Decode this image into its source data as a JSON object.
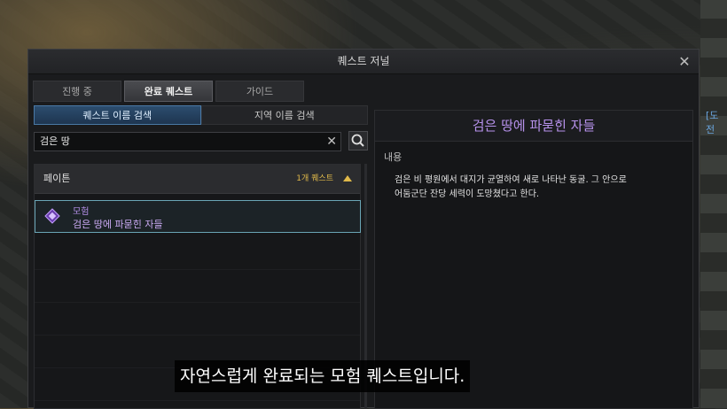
{
  "window": {
    "title": "퀘스트 저널"
  },
  "tabs": [
    {
      "label": "진행 중"
    },
    {
      "label": "완료 퀘스트"
    },
    {
      "label": "가이드"
    }
  ],
  "subtabs": [
    {
      "label": "퀘스트 이름 검색"
    },
    {
      "label": "지역 이름 검색"
    }
  ],
  "search": {
    "value": "검은 땅"
  },
  "group": {
    "name": "페이튼",
    "count": "1개 퀘스트"
  },
  "quest": {
    "type": "모험",
    "name": "검은 땅에 파묻힌 자들"
  },
  "detail": {
    "title": "검은 땅에 파묻힌 자들",
    "section_label": "내용",
    "description_line1": "검은 비 평원에서 대지가 균열하여 새로 나타난 동굴. 그 안으로",
    "description_line2": "어둠군단 잔당 세력이 도망쳤다고 한다."
  },
  "background": {
    "right_tag": "[도전"
  },
  "subtitle": "자연스럽게 완료되는 모험 퀘스트입니다.",
  "colors": {
    "accent_purple": "#b792ec",
    "highlight_blue": "#4a79a6",
    "count_gold": "#e0b94a"
  }
}
